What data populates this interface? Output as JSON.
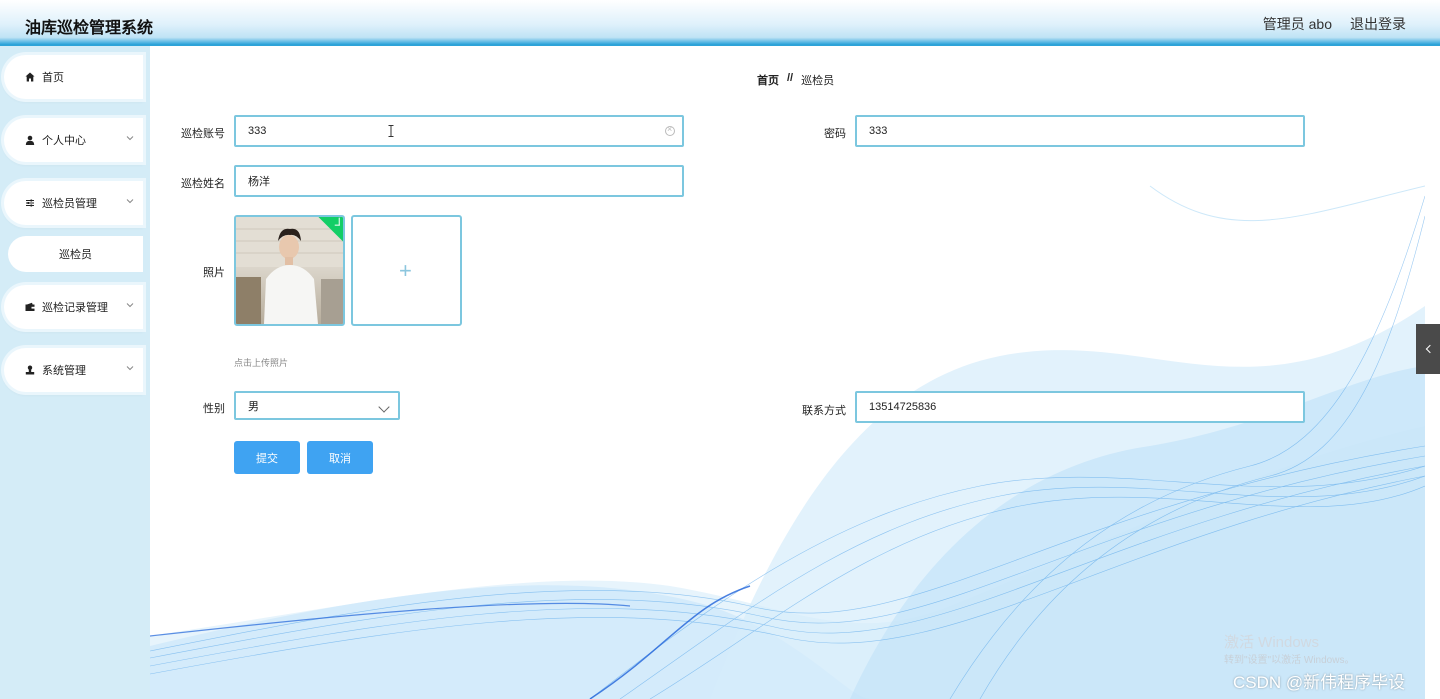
{
  "header": {
    "app_title": "油库巡检管理系统",
    "user_label": "管理员 abo",
    "logout_label": "退出登录"
  },
  "sidebar": {
    "items": [
      {
        "label": "首页",
        "icon": "home-icon"
      },
      {
        "label": "个人中心",
        "icon": "user-icon"
      },
      {
        "label": "巡检员管理",
        "icon": "sliders-icon"
      },
      {
        "label": "巡检记录管理",
        "icon": "wallet-icon"
      },
      {
        "label": "系统管理",
        "icon": "person-stamp-icon"
      }
    ],
    "active_sub": "巡检员"
  },
  "breadcrumb": {
    "home": "首页",
    "separator": "//",
    "current": "巡检员"
  },
  "form": {
    "account": {
      "label": "巡检账号",
      "value": "333"
    },
    "password": {
      "label": "密码",
      "value": "333"
    },
    "name": {
      "label": "巡检姓名",
      "value": "杨洋"
    },
    "photo": {
      "label": "照片",
      "hint": "点击上传照片"
    },
    "gender": {
      "label": "性别",
      "value": "男"
    },
    "contact": {
      "label": "联系方式",
      "value": "13514725836"
    }
  },
  "buttons": {
    "submit": "提交",
    "cancel": "取消"
  },
  "watermarks": {
    "activate_title": "激活 Windows",
    "activate_sub": "转到\"设置\"以激活 Windows。",
    "csdn": "CSDN @新伟程序毕设"
  },
  "colors": {
    "accent": "#3fa3f2",
    "input_border": "#7cc7df",
    "sidebar_bg": "#d4ecf7",
    "success": "#13ce66"
  }
}
